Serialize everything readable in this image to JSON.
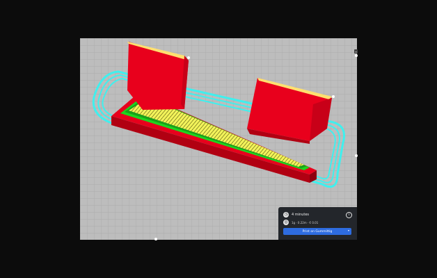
{
  "print_panel": {
    "time_label": "4 minutes",
    "cost_label": "1g · 0.22m · € 0.01",
    "print_button_label": "Print on Gummittig",
    "dropdown_glyph": "▾",
    "info_glyph": "i"
  },
  "viewport": {
    "side_handle_glyph": "≡"
  },
  "colors": {
    "buildplate": "#bdbdbd",
    "grid": "#a8a8a8",
    "skirt": "#3ff0ee",
    "wall": "#e8001c",
    "infill": "#f0f060",
    "inner_wall": "#22dd22"
  },
  "icons": [
    "clock-icon",
    "filament-icon",
    "info-icon",
    "chevron-down-icon"
  ]
}
